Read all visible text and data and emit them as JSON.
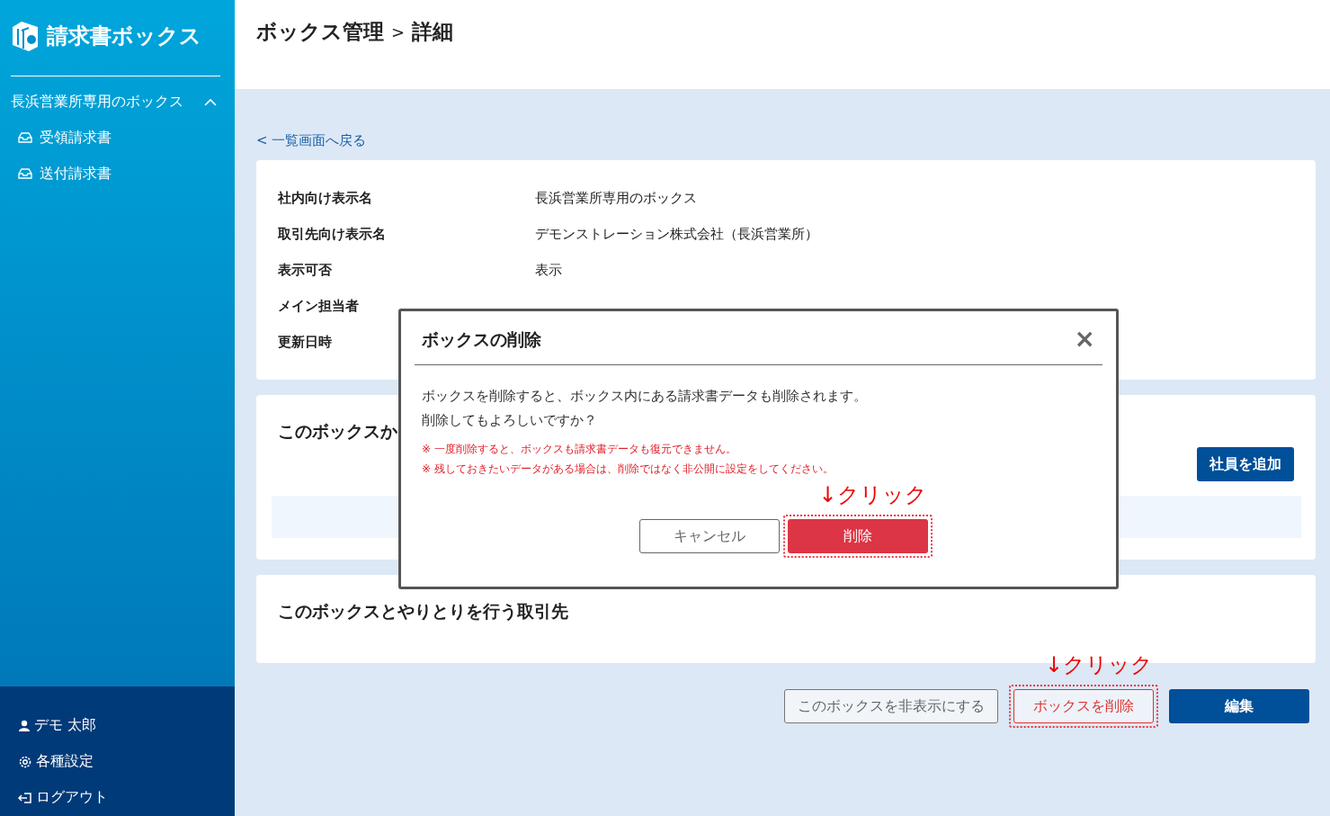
{
  "app": {
    "logo": "請求書ボックス"
  },
  "sidebar": {
    "group": {
      "label": "長浜営業所専用のボックス",
      "expanded": true,
      "items": [
        {
          "label": "受領請求書"
        },
        {
          "label": "送付請求書"
        }
      ]
    },
    "footer": [
      {
        "kind": "user",
        "label": "デモ 太郎"
      },
      {
        "kind": "settings",
        "label": "各種設定"
      },
      {
        "kind": "logout",
        "label": "ログアウト"
      }
    ]
  },
  "header": {
    "breadcrumb": [
      "ボックス管理",
      "詳細"
    ],
    "separator": ">"
  },
  "back_link": "< 一覧画面へ戻る",
  "details": [
    {
      "label": "社内向け表示名",
      "value": "長浜営業所専用のボックス"
    },
    {
      "label": "取引先向け表示名",
      "value": "デモンストレーション株式会社（長浜営業所）"
    },
    {
      "label": "表示可否",
      "value": "表示"
    },
    {
      "label": "メイン担当者"
    },
    {
      "label": "更新日時"
    }
  ],
  "sections": [
    {
      "title": "このボックスか",
      "button": "社員を追加"
    },
    {
      "title": "このボックスとやりとりを行う取引先"
    }
  ],
  "actions": [
    {
      "kind": "outline",
      "label": "このボックスを非表示にする"
    },
    {
      "kind": "danger",
      "label": "ボックスを削除",
      "annotation": "↓クリック"
    },
    {
      "kind": "primary",
      "label": "編集"
    }
  ],
  "modal": {
    "title": "ボックスの削除",
    "close": "×",
    "message": [
      "ボックスを削除すると、ボックス内にある請求書データも削除されます。",
      "削除してもよろしいですか？"
    ],
    "notes": [
      "※ 一度削除すると、ボックスも請求書データも復元できません。",
      "※ 残しておきたいデータがある場合は、削除ではなく非公開に設定をしてください。"
    ],
    "buttons": [
      {
        "kind": "cancel",
        "label": "キャンセル"
      },
      {
        "kind": "danger",
        "label": "削除",
        "annotation": "↓クリック"
      }
    ]
  }
}
